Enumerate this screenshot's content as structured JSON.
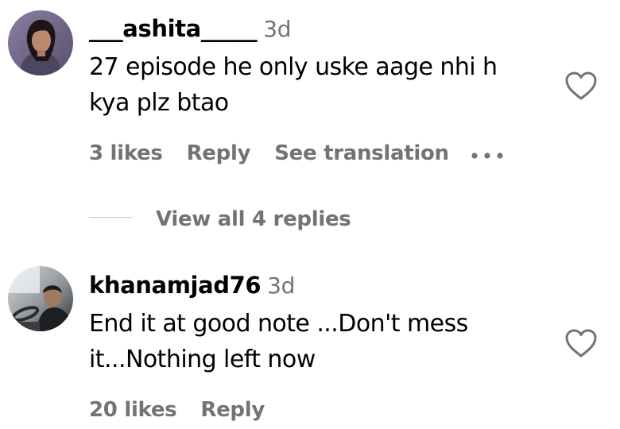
{
  "comments": [
    {
      "username": "___ashita_____",
      "time": "3d",
      "text": "27 episode he only uske aage nhi h\nkya plz btao",
      "likes": "3 likes",
      "reply_label": "Reply",
      "see_translation_label": "See translation",
      "view_replies_label": "View all 4 replies",
      "avatar_icon": "avatar-woman-icon",
      "heart_icon": "heart-outline-icon",
      "more_icon": "more-horizontal-icon"
    },
    {
      "username": "khanamjad76",
      "time": "3d",
      "text": "End it at good note ...Don't mess\nit...Nothing left now",
      "likes": "20 likes",
      "reply_label": "Reply",
      "avatar_icon": "avatar-man-driving-icon",
      "heart_icon": "heart-outline-icon"
    }
  ],
  "colors": {
    "text_primary": "#000000",
    "text_secondary": "#737373",
    "divider": "#c7c7c7"
  }
}
